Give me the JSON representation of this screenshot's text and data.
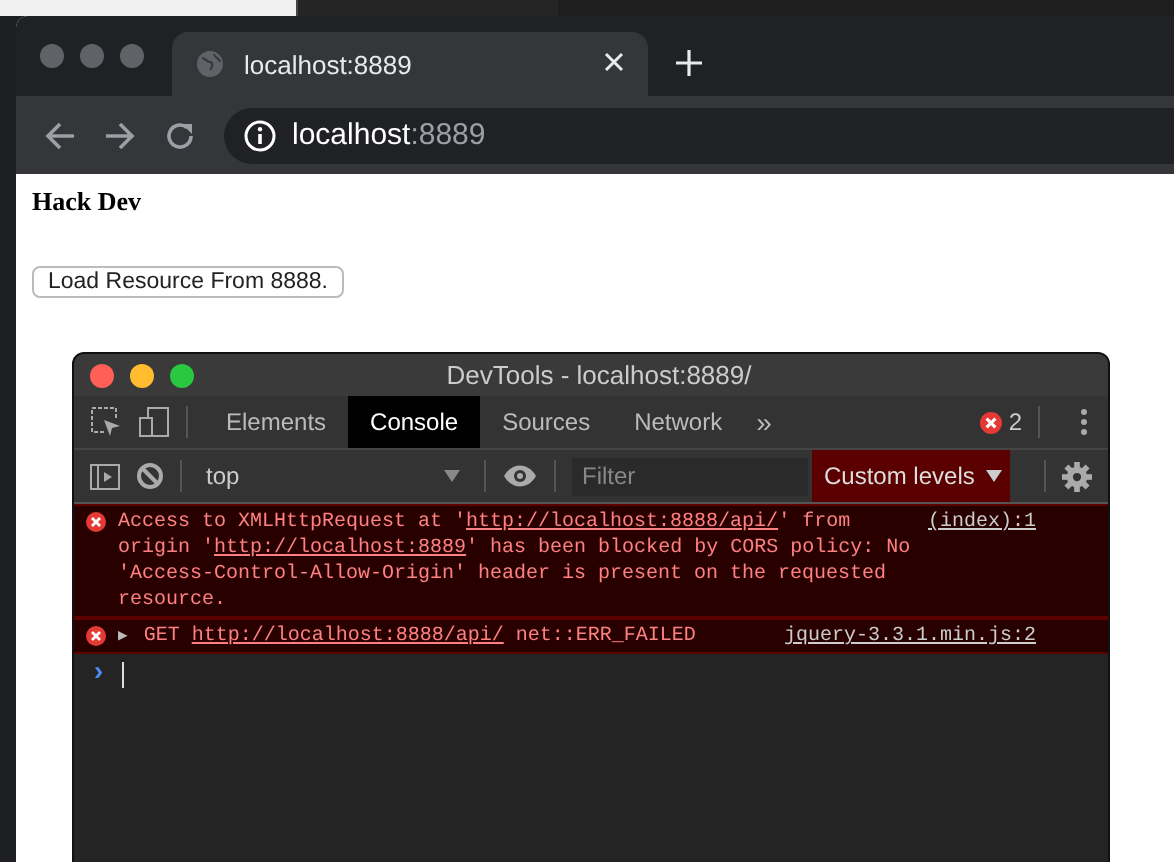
{
  "browser": {
    "tab": {
      "title": "localhost:8889",
      "selected": true
    },
    "address": {
      "host": "localhost",
      "port": ":8889"
    }
  },
  "page": {
    "heading": "Hack Dev",
    "button": "Load Resource From 8888."
  },
  "devtools": {
    "title": "DevTools - localhost:8889/",
    "tabs": [
      {
        "label": "Elements",
        "selected": false
      },
      {
        "label": "Console",
        "selected": true
      },
      {
        "label": "Sources",
        "selected": false
      },
      {
        "label": "Network",
        "selected": false
      }
    ],
    "more": "»",
    "error_count": "2",
    "context": "top",
    "filter": {
      "placeholder": "Filter"
    },
    "levels": "Custom levels",
    "messages": [
      {
        "kind": "error",
        "parts": [
          {
            "kind": "text",
            "text": "Access to XMLHttpRequest at '"
          },
          {
            "kind": "link",
            "text": "http://localhost:8888/api/"
          },
          {
            "kind": "text",
            "text": "' from origin '"
          },
          {
            "kind": "link",
            "text": "http://localhost:8889"
          },
          {
            "kind": "text",
            "text": "' has been blocked by CORS policy: No 'Access-Control-Allow-Origin' header is present on the requested resource."
          }
        ],
        "source": "(index):1"
      },
      {
        "kind": "error",
        "toggle": "▶",
        "parts": [
          {
            "kind": "text",
            "text": "GET "
          },
          {
            "kind": "link",
            "text": "http://localhost:8888/api/"
          },
          {
            "kind": "text",
            "text": " net::ERR_FAILED"
          }
        ],
        "source": "jquery-3.3.1.min.js:2"
      }
    ],
    "prompt": "›"
  }
}
